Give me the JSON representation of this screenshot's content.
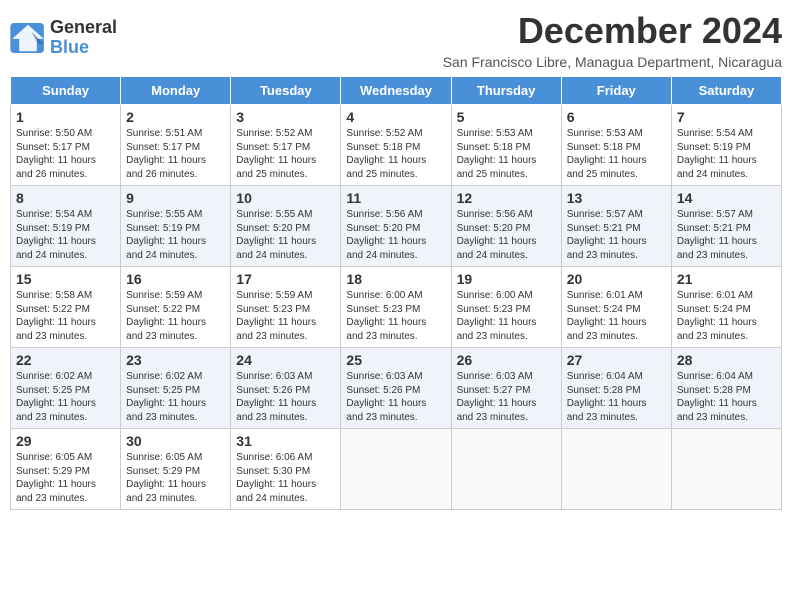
{
  "header": {
    "logo_line1": "General",
    "logo_line2": "Blue",
    "month_title": "December 2024",
    "subtitle": "San Francisco Libre, Managua Department, Nicaragua"
  },
  "weekdays": [
    "Sunday",
    "Monday",
    "Tuesday",
    "Wednesday",
    "Thursday",
    "Friday",
    "Saturday"
  ],
  "weeks": [
    [
      {
        "day": "1",
        "info": "Sunrise: 5:50 AM\nSunset: 5:17 PM\nDaylight: 11 hours\nand 26 minutes."
      },
      {
        "day": "2",
        "info": "Sunrise: 5:51 AM\nSunset: 5:17 PM\nDaylight: 11 hours\nand 26 minutes."
      },
      {
        "day": "3",
        "info": "Sunrise: 5:52 AM\nSunset: 5:17 PM\nDaylight: 11 hours\nand 25 minutes."
      },
      {
        "day": "4",
        "info": "Sunrise: 5:52 AM\nSunset: 5:18 PM\nDaylight: 11 hours\nand 25 minutes."
      },
      {
        "day": "5",
        "info": "Sunrise: 5:53 AM\nSunset: 5:18 PM\nDaylight: 11 hours\nand 25 minutes."
      },
      {
        "day": "6",
        "info": "Sunrise: 5:53 AM\nSunset: 5:18 PM\nDaylight: 11 hours\nand 25 minutes."
      },
      {
        "day": "7",
        "info": "Sunrise: 5:54 AM\nSunset: 5:19 PM\nDaylight: 11 hours\nand 24 minutes."
      }
    ],
    [
      {
        "day": "8",
        "info": "Sunrise: 5:54 AM\nSunset: 5:19 PM\nDaylight: 11 hours\nand 24 minutes."
      },
      {
        "day": "9",
        "info": "Sunrise: 5:55 AM\nSunset: 5:19 PM\nDaylight: 11 hours\nand 24 minutes."
      },
      {
        "day": "10",
        "info": "Sunrise: 5:55 AM\nSunset: 5:20 PM\nDaylight: 11 hours\nand 24 minutes."
      },
      {
        "day": "11",
        "info": "Sunrise: 5:56 AM\nSunset: 5:20 PM\nDaylight: 11 hours\nand 24 minutes."
      },
      {
        "day": "12",
        "info": "Sunrise: 5:56 AM\nSunset: 5:20 PM\nDaylight: 11 hours\nand 24 minutes."
      },
      {
        "day": "13",
        "info": "Sunrise: 5:57 AM\nSunset: 5:21 PM\nDaylight: 11 hours\nand 23 minutes."
      },
      {
        "day": "14",
        "info": "Sunrise: 5:57 AM\nSunset: 5:21 PM\nDaylight: 11 hours\nand 23 minutes."
      }
    ],
    [
      {
        "day": "15",
        "info": "Sunrise: 5:58 AM\nSunset: 5:22 PM\nDaylight: 11 hours\nand 23 minutes."
      },
      {
        "day": "16",
        "info": "Sunrise: 5:59 AM\nSunset: 5:22 PM\nDaylight: 11 hours\nand 23 minutes."
      },
      {
        "day": "17",
        "info": "Sunrise: 5:59 AM\nSunset: 5:23 PM\nDaylight: 11 hours\nand 23 minutes."
      },
      {
        "day": "18",
        "info": "Sunrise: 6:00 AM\nSunset: 5:23 PM\nDaylight: 11 hours\nand 23 minutes."
      },
      {
        "day": "19",
        "info": "Sunrise: 6:00 AM\nSunset: 5:23 PM\nDaylight: 11 hours\nand 23 minutes."
      },
      {
        "day": "20",
        "info": "Sunrise: 6:01 AM\nSunset: 5:24 PM\nDaylight: 11 hours\nand 23 minutes."
      },
      {
        "day": "21",
        "info": "Sunrise: 6:01 AM\nSunset: 5:24 PM\nDaylight: 11 hours\nand 23 minutes."
      }
    ],
    [
      {
        "day": "22",
        "info": "Sunrise: 6:02 AM\nSunset: 5:25 PM\nDaylight: 11 hours\nand 23 minutes."
      },
      {
        "day": "23",
        "info": "Sunrise: 6:02 AM\nSunset: 5:25 PM\nDaylight: 11 hours\nand 23 minutes."
      },
      {
        "day": "24",
        "info": "Sunrise: 6:03 AM\nSunset: 5:26 PM\nDaylight: 11 hours\nand 23 minutes."
      },
      {
        "day": "25",
        "info": "Sunrise: 6:03 AM\nSunset: 5:26 PM\nDaylight: 11 hours\nand 23 minutes."
      },
      {
        "day": "26",
        "info": "Sunrise: 6:03 AM\nSunset: 5:27 PM\nDaylight: 11 hours\nand 23 minutes."
      },
      {
        "day": "27",
        "info": "Sunrise: 6:04 AM\nSunset: 5:28 PM\nDaylight: 11 hours\nand 23 minutes."
      },
      {
        "day": "28",
        "info": "Sunrise: 6:04 AM\nSunset: 5:28 PM\nDaylight: 11 hours\nand 23 minutes."
      }
    ],
    [
      {
        "day": "29",
        "info": "Sunrise: 6:05 AM\nSunset: 5:29 PM\nDaylight: 11 hours\nand 23 minutes."
      },
      {
        "day": "30",
        "info": "Sunrise: 6:05 AM\nSunset: 5:29 PM\nDaylight: 11 hours\nand 23 minutes."
      },
      {
        "day": "31",
        "info": "Sunrise: 6:06 AM\nSunset: 5:30 PM\nDaylight: 11 hours\nand 24 minutes."
      },
      {
        "day": "",
        "info": ""
      },
      {
        "day": "",
        "info": ""
      },
      {
        "day": "",
        "info": ""
      },
      {
        "day": "",
        "info": ""
      }
    ]
  ]
}
